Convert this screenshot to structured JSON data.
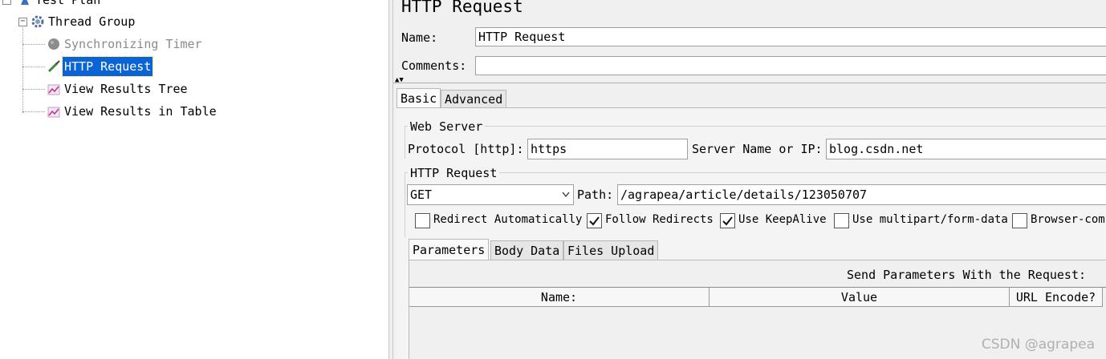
{
  "tree": {
    "items": [
      {
        "label": "Test Plan",
        "icon": "test-plan-icon",
        "enabled": true
      },
      {
        "label": "Thread Group",
        "icon": "thread-group-gear-icon",
        "enabled": true
      },
      {
        "label": "Synchronizing Timer",
        "icon": "timer-icon",
        "enabled": false
      },
      {
        "label": "HTTP Request",
        "icon": "sampler-pipette-icon",
        "enabled": true,
        "selected": true
      },
      {
        "label": "View Results Tree",
        "icon": "listener-graph-icon",
        "enabled": true
      },
      {
        "label": "View Results in Table",
        "icon": "listener-graph-icon",
        "enabled": true
      }
    ]
  },
  "panel": {
    "title": "HTTP Request",
    "name_label": "Name:",
    "name_value": "HTTP Request",
    "comments_label": "Comments:",
    "comments_value": "",
    "tabs": [
      "Basic",
      "Advanced"
    ],
    "active_tab": "Basic",
    "web_server": {
      "group_title": "Web Server",
      "protocol_label": "Protocol [http]:",
      "protocol_value": "https",
      "server_label": "Server Name or IP:",
      "server_value": "blog.csdn.net"
    },
    "http_request": {
      "group_title": "HTTP Request",
      "method_value": "GET",
      "path_label": "Path:",
      "path_value": "/agrapea/article/details/123050707",
      "checkboxes": [
        {
          "label": "Redirect Automatically",
          "checked": false
        },
        {
          "label": "Follow Redirects",
          "checked": true
        },
        {
          "label": "Use KeepAlive",
          "checked": true
        },
        {
          "label": "Use multipart/form-data",
          "checked": false
        },
        {
          "label": "Browser-comp",
          "checked": false
        }
      ]
    },
    "param_tabs": [
      "Parameters",
      "Body Data",
      "Files Upload"
    ],
    "active_param_tab": "Parameters",
    "send_params_label": "Send Parameters With the Request:",
    "table_headers": [
      "Name:",
      "Value",
      "URL Encode?"
    ]
  },
  "watermark": "CSDN @agrapea",
  "colors": {
    "selection": "#0a64d6",
    "panel_bg": "#f0f0f0",
    "disabled_text": "#8a8a8a"
  }
}
